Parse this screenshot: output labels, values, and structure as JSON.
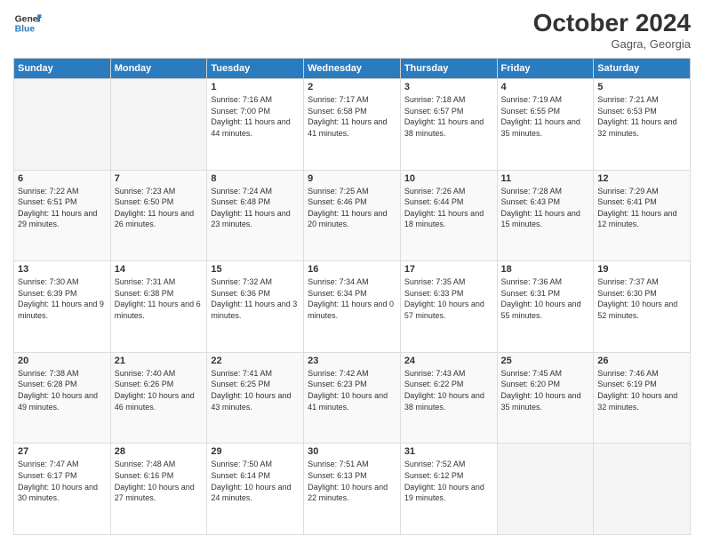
{
  "header": {
    "logo_line1": "General",
    "logo_line2": "Blue",
    "month": "October 2024",
    "location": "Gagra, Georgia"
  },
  "weekdays": [
    "Sunday",
    "Monday",
    "Tuesday",
    "Wednesday",
    "Thursday",
    "Friday",
    "Saturday"
  ],
  "weeks": [
    [
      {
        "day": "",
        "info": ""
      },
      {
        "day": "",
        "info": ""
      },
      {
        "day": "1",
        "info": "Sunrise: 7:16 AM\nSunset: 7:00 PM\nDaylight: 11 hours and 44 minutes."
      },
      {
        "day": "2",
        "info": "Sunrise: 7:17 AM\nSunset: 6:58 PM\nDaylight: 11 hours and 41 minutes."
      },
      {
        "day": "3",
        "info": "Sunrise: 7:18 AM\nSunset: 6:57 PM\nDaylight: 11 hours and 38 minutes."
      },
      {
        "day": "4",
        "info": "Sunrise: 7:19 AM\nSunset: 6:55 PM\nDaylight: 11 hours and 35 minutes."
      },
      {
        "day": "5",
        "info": "Sunrise: 7:21 AM\nSunset: 6:53 PM\nDaylight: 11 hours and 32 minutes."
      }
    ],
    [
      {
        "day": "6",
        "info": "Sunrise: 7:22 AM\nSunset: 6:51 PM\nDaylight: 11 hours and 29 minutes."
      },
      {
        "day": "7",
        "info": "Sunrise: 7:23 AM\nSunset: 6:50 PM\nDaylight: 11 hours and 26 minutes."
      },
      {
        "day": "8",
        "info": "Sunrise: 7:24 AM\nSunset: 6:48 PM\nDaylight: 11 hours and 23 minutes."
      },
      {
        "day": "9",
        "info": "Sunrise: 7:25 AM\nSunset: 6:46 PM\nDaylight: 11 hours and 20 minutes."
      },
      {
        "day": "10",
        "info": "Sunrise: 7:26 AM\nSunset: 6:44 PM\nDaylight: 11 hours and 18 minutes."
      },
      {
        "day": "11",
        "info": "Sunrise: 7:28 AM\nSunset: 6:43 PM\nDaylight: 11 hours and 15 minutes."
      },
      {
        "day": "12",
        "info": "Sunrise: 7:29 AM\nSunset: 6:41 PM\nDaylight: 11 hours and 12 minutes."
      }
    ],
    [
      {
        "day": "13",
        "info": "Sunrise: 7:30 AM\nSunset: 6:39 PM\nDaylight: 11 hours and 9 minutes."
      },
      {
        "day": "14",
        "info": "Sunrise: 7:31 AM\nSunset: 6:38 PM\nDaylight: 11 hours and 6 minutes."
      },
      {
        "day": "15",
        "info": "Sunrise: 7:32 AM\nSunset: 6:36 PM\nDaylight: 11 hours and 3 minutes."
      },
      {
        "day": "16",
        "info": "Sunrise: 7:34 AM\nSunset: 6:34 PM\nDaylight: 11 hours and 0 minutes."
      },
      {
        "day": "17",
        "info": "Sunrise: 7:35 AM\nSunset: 6:33 PM\nDaylight: 10 hours and 57 minutes."
      },
      {
        "day": "18",
        "info": "Sunrise: 7:36 AM\nSunset: 6:31 PM\nDaylight: 10 hours and 55 minutes."
      },
      {
        "day": "19",
        "info": "Sunrise: 7:37 AM\nSunset: 6:30 PM\nDaylight: 10 hours and 52 minutes."
      }
    ],
    [
      {
        "day": "20",
        "info": "Sunrise: 7:38 AM\nSunset: 6:28 PM\nDaylight: 10 hours and 49 minutes."
      },
      {
        "day": "21",
        "info": "Sunrise: 7:40 AM\nSunset: 6:26 PM\nDaylight: 10 hours and 46 minutes."
      },
      {
        "day": "22",
        "info": "Sunrise: 7:41 AM\nSunset: 6:25 PM\nDaylight: 10 hours and 43 minutes."
      },
      {
        "day": "23",
        "info": "Sunrise: 7:42 AM\nSunset: 6:23 PM\nDaylight: 10 hours and 41 minutes."
      },
      {
        "day": "24",
        "info": "Sunrise: 7:43 AM\nSunset: 6:22 PM\nDaylight: 10 hours and 38 minutes."
      },
      {
        "day": "25",
        "info": "Sunrise: 7:45 AM\nSunset: 6:20 PM\nDaylight: 10 hours and 35 minutes."
      },
      {
        "day": "26",
        "info": "Sunrise: 7:46 AM\nSunset: 6:19 PM\nDaylight: 10 hours and 32 minutes."
      }
    ],
    [
      {
        "day": "27",
        "info": "Sunrise: 7:47 AM\nSunset: 6:17 PM\nDaylight: 10 hours and 30 minutes."
      },
      {
        "day": "28",
        "info": "Sunrise: 7:48 AM\nSunset: 6:16 PM\nDaylight: 10 hours and 27 minutes."
      },
      {
        "day": "29",
        "info": "Sunrise: 7:50 AM\nSunset: 6:14 PM\nDaylight: 10 hours and 24 minutes."
      },
      {
        "day": "30",
        "info": "Sunrise: 7:51 AM\nSunset: 6:13 PM\nDaylight: 10 hours and 22 minutes."
      },
      {
        "day": "31",
        "info": "Sunrise: 7:52 AM\nSunset: 6:12 PM\nDaylight: 10 hours and 19 minutes."
      },
      {
        "day": "",
        "info": ""
      },
      {
        "day": "",
        "info": ""
      }
    ]
  ]
}
